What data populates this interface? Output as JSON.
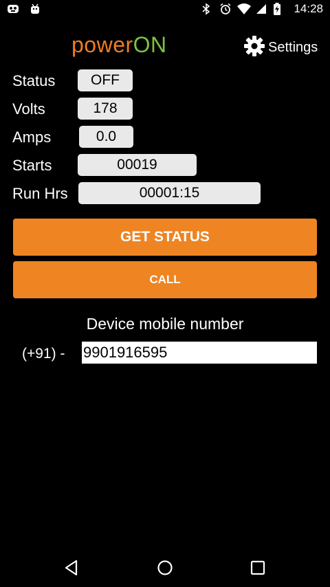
{
  "status_bar": {
    "time": "14:28",
    "left_icons": [
      "game-controller-icon",
      "android-icon"
    ],
    "right_icons": [
      "bluetooth-icon",
      "alarm-icon",
      "wifi-icon",
      "signal-icon",
      "battery-charging-icon"
    ]
  },
  "header": {
    "logo_power": "power",
    "logo_on": "ON",
    "settings_label": "Settings"
  },
  "fields": {
    "status_label": "Status",
    "status_value": "OFF",
    "volts_label": "Volts",
    "volts_value": "178",
    "amps_label": "Amps",
    "amps_value": "0.0",
    "starts_label": "Starts",
    "starts_value": "00019",
    "runhrs_label": "Run Hrs",
    "runhrs_value": "00001:15"
  },
  "buttons": {
    "get_status": "GET STATUS",
    "call": "CALL"
  },
  "device": {
    "label": "Device mobile number",
    "prefix": "(+91) -",
    "number": "9901916595"
  },
  "colors": {
    "accent_orange": "#ef8422",
    "logo_green": "#7ec242",
    "background": "#000000",
    "field_bg": "#e9e9e9"
  },
  "nav": {
    "icons": [
      "back-icon",
      "home-icon",
      "recents-icon"
    ]
  }
}
